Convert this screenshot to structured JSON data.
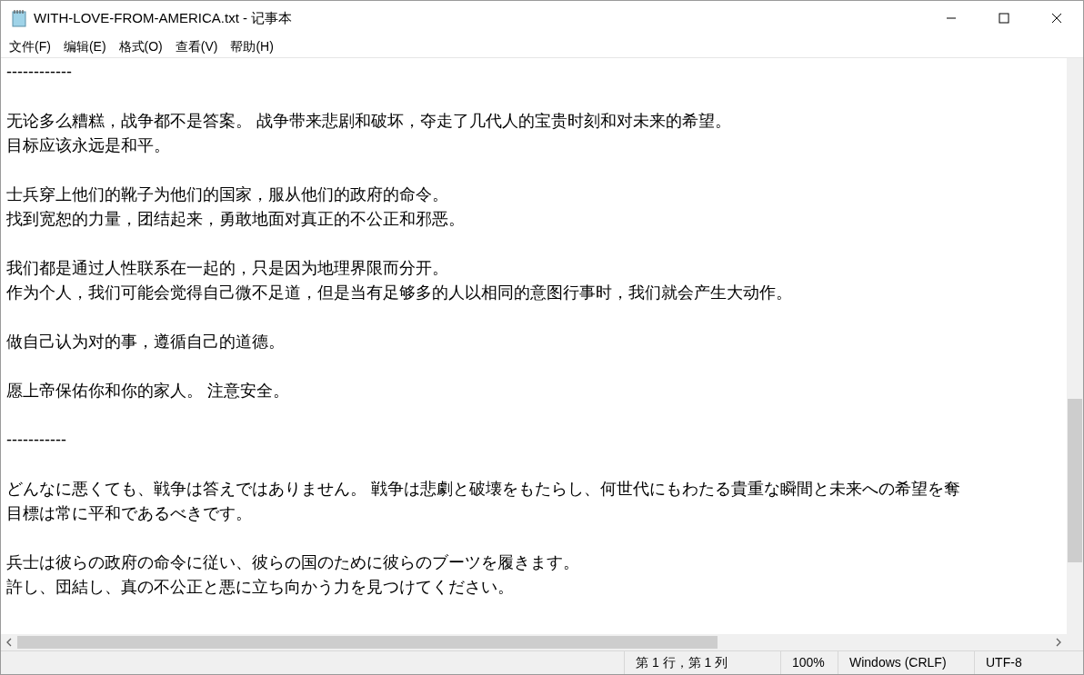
{
  "window": {
    "title": "WITH-LOVE-FROM-AMERICA.txt - 记事本"
  },
  "menu": [
    "文件(F)",
    "编辑(E)",
    "格式(O)",
    "查看(V)",
    "帮助(H)"
  ],
  "editor": {
    "paragraphs": [
      [
        "------------"
      ],
      [
        "无论多么糟糕，战争都不是答案。 战争带来悲剧和破坏，夺走了几代人的宝贵时刻和对未来的希望。",
        "目标应该永远是和平。"
      ],
      [
        "士兵穿上他们的靴子为他们的国家，服从他们的政府的命令。",
        "找到宽恕的力量，团结起来，勇敢地面对真正的不公正和邪恶。"
      ],
      [
        "我们都是通过人性联系在一起的，只是因为地理界限而分开。",
        "作为个人，我们可能会觉得自己微不足道，但是当有足够多的人以相同的意图行事时，我们就会产生大动作。"
      ],
      [
        "做自己认为对的事，遵循自己的道德。"
      ],
      [
        "愿上帝保佑你和你的家人。 注意安全。"
      ],
      [
        "-----------"
      ],
      [
        "どんなに悪くても、戦争は答えではありません。 戦争は悲劇と破壊をもたらし、何世代にもわたる貴重な瞬間と未来への希望を奪",
        "目標は常に平和であるべきです。"
      ],
      [
        "兵士は彼らの政府の命令に従い、彼らの国のために彼らのブーツを履きます。",
        "許し、団結し、真の不公正と悪に立ち向かう力を見つけてください。"
      ]
    ]
  },
  "status_bar": [
    "第 1 行，第 1 列",
    "100%",
    "Windows (CRLF)",
    "UTF-8"
  ]
}
